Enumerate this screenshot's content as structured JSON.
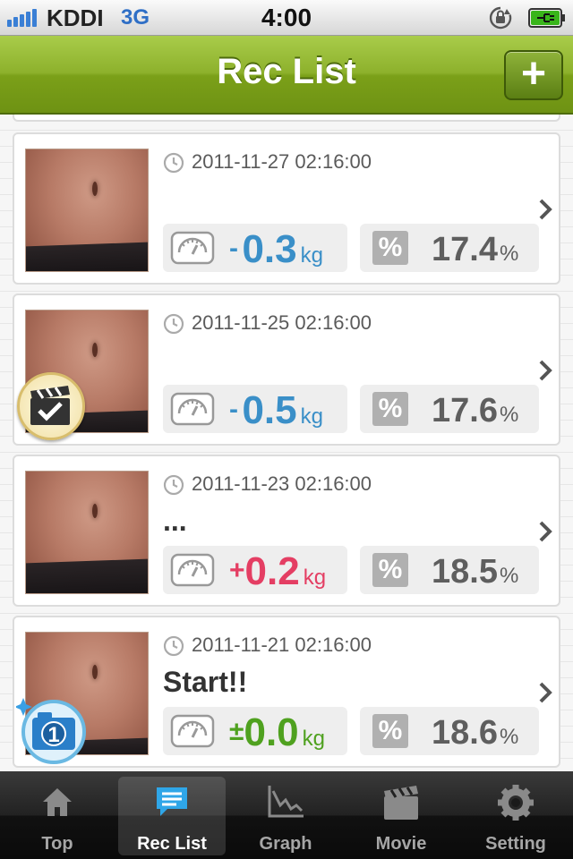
{
  "status_bar": {
    "carrier": "KDDI",
    "network": "3G",
    "time": "4:00",
    "icons": [
      "signal-icon",
      "rotation-lock-icon",
      "battery-charging-icon"
    ]
  },
  "nav_bar": {
    "title": "Rec List",
    "add_label": "+"
  },
  "records": [
    {
      "date": "2011-11-27 02:16:00",
      "memo": "",
      "weight_sign": "-",
      "weight_value": "0.3",
      "weight_unit": "kg",
      "trend": "down",
      "fat_value": "17.4",
      "fat_unit": "%",
      "badge": ""
    },
    {
      "date": "2011-11-25 02:16:00",
      "memo": "",
      "weight_sign": "-",
      "weight_value": "0.5",
      "weight_unit": "kg",
      "trend": "down",
      "fat_value": "17.6",
      "fat_unit": "%",
      "badge": "movie-checked-icon"
    },
    {
      "date": "2011-11-23 02:16:00",
      "memo": "...",
      "weight_sign": "+",
      "weight_value": "0.2",
      "weight_unit": "kg",
      "trend": "up",
      "fat_value": "18.5",
      "fat_unit": "%",
      "badge": ""
    },
    {
      "date": "2011-11-21 02:16:00",
      "memo": "Start!!",
      "weight_sign": "±",
      "weight_value": "0.0",
      "weight_unit": "kg",
      "trend": "flat",
      "fat_value": "18.6",
      "fat_unit": "%",
      "badge": "first-photo-icon"
    }
  ],
  "percent_symbol": "%",
  "colors": {
    "down": "#3a8fc8",
    "up": "#e43e63",
    "flat": "#4fa11f",
    "nav_green": "#8db12c"
  },
  "tab_bar": {
    "tabs": [
      {
        "label": "Top",
        "icon": "home-icon",
        "active": false
      },
      {
        "label": "Rec List",
        "icon": "speech-bubble-list-icon",
        "active": true
      },
      {
        "label": "Graph",
        "icon": "graph-icon",
        "active": false
      },
      {
        "label": "Movie",
        "icon": "clapperboard-icon",
        "active": false
      },
      {
        "label": "Setting",
        "icon": "gear-icon",
        "active": false
      }
    ]
  }
}
